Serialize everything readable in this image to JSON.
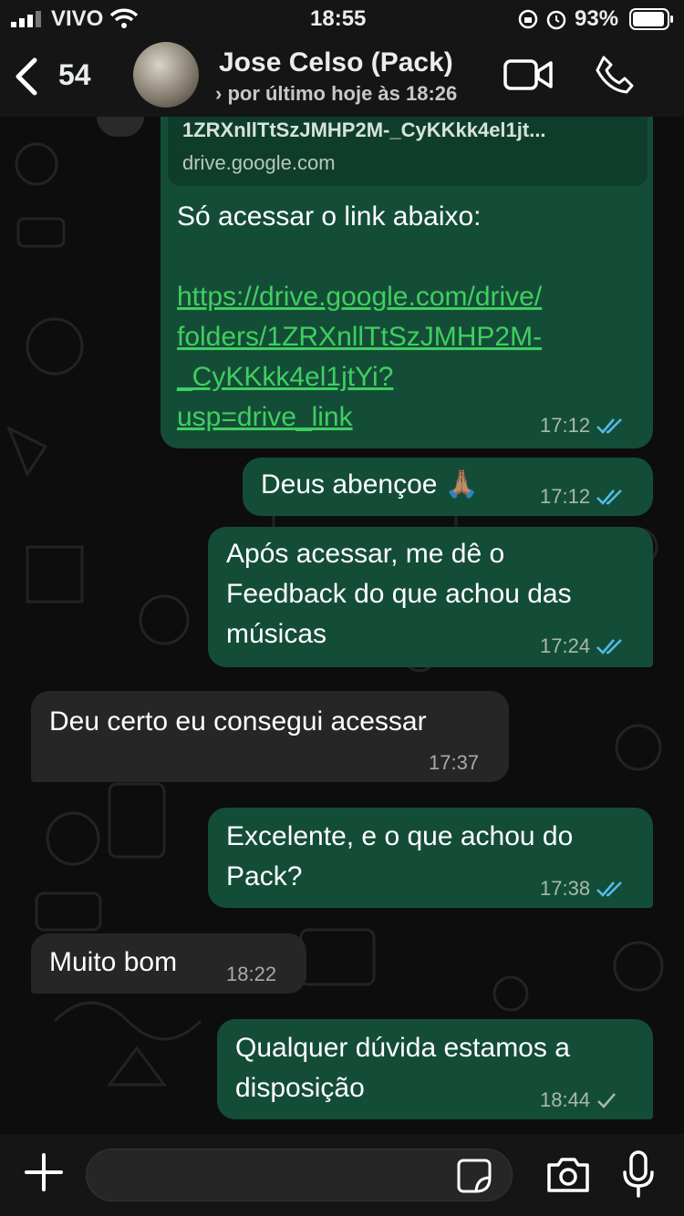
{
  "status_bar": {
    "carrier": "VIVO",
    "time": "18:55",
    "battery": "93%"
  },
  "header": {
    "unread_count": "54",
    "contact_name": "Jose Celso (Pack)",
    "last_seen": "› por último hoje às 18:26"
  },
  "messages": [
    {
      "direction": "out",
      "preview_title": "1ZRXnllTtSzJMHP2M-_CyKKkk4el1jt...",
      "preview_domain": "drive.google.com",
      "text": "Só acessar o link abaixo:",
      "link": "https://drive.google.com/drive/\nfolders/1ZRXnllTtSzJMHP2M-\n_CyKKkk4el1jtYi?\nusp=drive_link",
      "time": "17:12",
      "status": "read"
    },
    {
      "direction": "out",
      "text": "Deus abençoe 🙏🏽",
      "time": "17:12",
      "status": "read"
    },
    {
      "direction": "out",
      "text": "Após acessar, me dê o\nFeedback do que achou das\nmúsicas",
      "time": "17:24",
      "status": "read"
    },
    {
      "direction": "in",
      "text": "Deu certo eu consegui acessar",
      "time": "17:37"
    },
    {
      "direction": "out",
      "text": "Excelente, e o que achou do\nPack?",
      "time": "17:38",
      "status": "read"
    },
    {
      "direction": "in",
      "text": "Muito bom",
      "time": "18:22"
    },
    {
      "direction": "out",
      "text": "Qualquer dúvida estamos a\ndisposição",
      "time": "18:44",
      "status": "delivered"
    }
  ],
  "input": {
    "placeholder": ""
  },
  "colors": {
    "outgoing_bubble": "#144d37",
    "incoming_bubble": "#262626",
    "link": "#3fcf60",
    "read_tick": "#53bdeb"
  }
}
